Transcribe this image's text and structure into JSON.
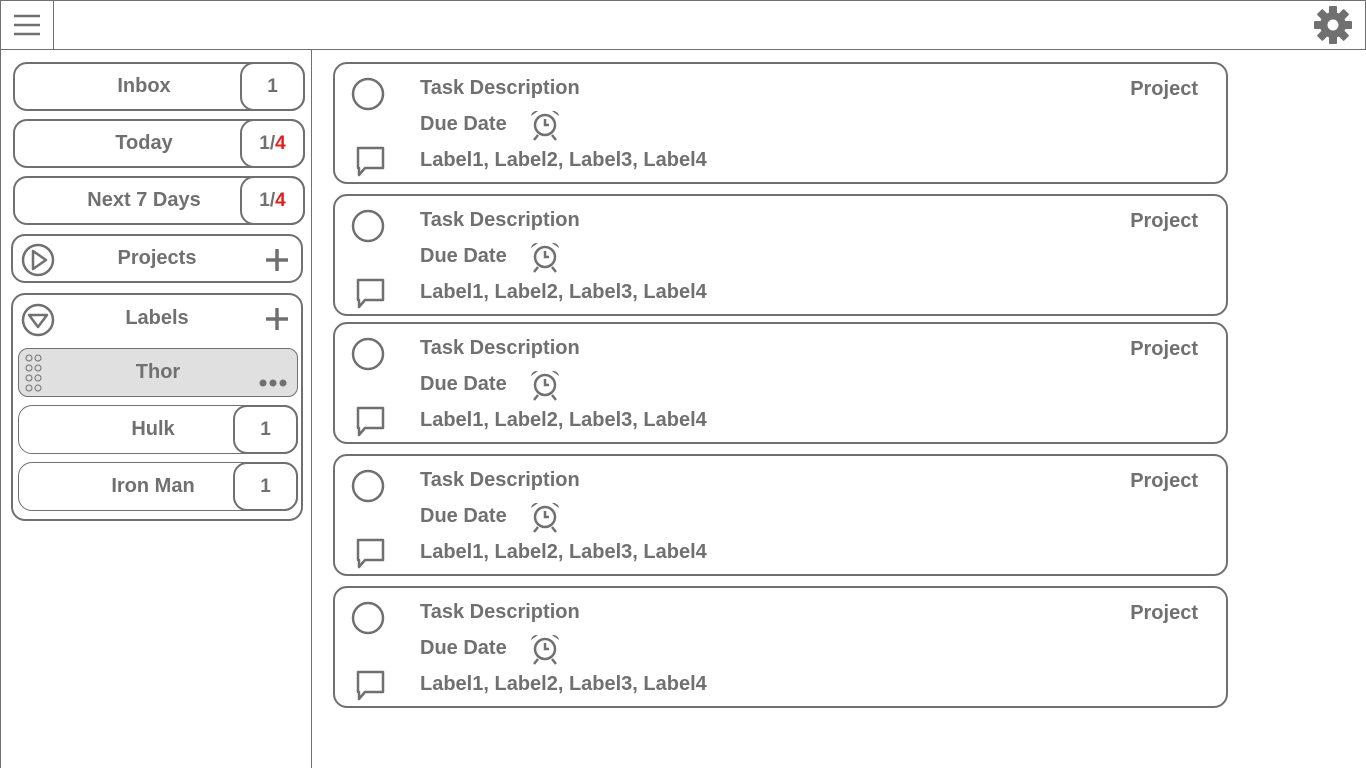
{
  "header": {
    "menu_icon": "hamburger-icon",
    "settings_icon": "gear-icon"
  },
  "sidebar": {
    "filters": [
      {
        "label": "Inbox",
        "count": "1",
        "count_total": ""
      },
      {
        "label": "Today",
        "count": "1/",
        "count_total": "4"
      },
      {
        "label": "Next 7 Days",
        "count": "1/",
        "count_total": "4"
      }
    ],
    "projects": {
      "label": "Projects"
    },
    "labels": {
      "label": "Labels",
      "items": [
        {
          "label": "Thor",
          "count": ""
        },
        {
          "label": "Hulk",
          "count": "1"
        },
        {
          "label": "Iron Man",
          "count": "1"
        }
      ]
    },
    "accent_color": "#e02020"
  },
  "tasks": [
    {
      "description": "Task Description",
      "project": "Project",
      "due": "Due Date",
      "labels": "Label1, Label2, Label3, Label4"
    },
    {
      "description": "Task Description",
      "project": "Project",
      "due": "Due Date",
      "labels": "Label1, Label2, Label3, Label4"
    },
    {
      "description": "Task Description",
      "project": "Project",
      "due": "Due Date",
      "labels": "Label1, Label2, Label3, Label4"
    },
    {
      "description": "Task Description",
      "project": "Project",
      "due": "Due Date",
      "labels": "Label1, Label2, Label3, Label4"
    },
    {
      "description": "Task Description",
      "project": "Project",
      "due": "Due Date",
      "labels": "Label1, Label2, Label3, Label4"
    }
  ]
}
